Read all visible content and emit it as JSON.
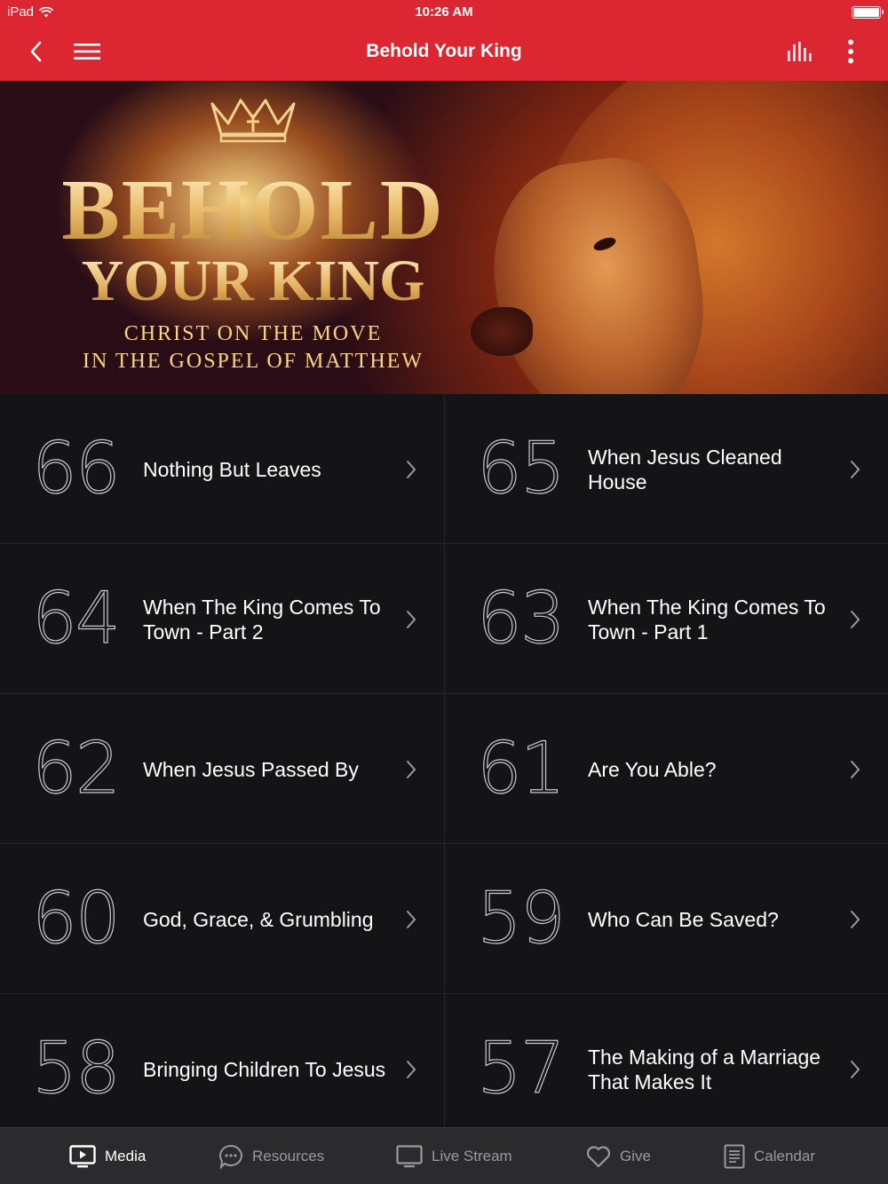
{
  "status_bar": {
    "device": "iPad",
    "time": "10:26 AM"
  },
  "nav": {
    "title": "Behold Your King",
    "back_icon": "chevron-left-icon",
    "menu_icon": "hamburger-icon",
    "audio_icon": "equalizer-icon",
    "more_icon": "more-vertical-icon"
  },
  "hero": {
    "line1": "BEHOLD",
    "line2": "YOUR KING",
    "line3": "CHRIST ON THE MOVE",
    "line4": "IN THE GOSPEL OF MATTHEW"
  },
  "episodes": [
    {
      "number": "66",
      "title": "Nothing But Leaves"
    },
    {
      "number": "65",
      "title": "When Jesus Cleaned House"
    },
    {
      "number": "64",
      "title": "When The King Comes To Town - Part 2"
    },
    {
      "number": "63",
      "title": "When The King Comes To Town - Part 1"
    },
    {
      "number": "62",
      "title": "When Jesus Passed By"
    },
    {
      "number": "61",
      "title": "Are You Able?"
    },
    {
      "number": "60",
      "title": "God, Grace, & Grumbling"
    },
    {
      "number": "59",
      "title": "Who Can Be Saved?"
    },
    {
      "number": "58",
      "title": "Bringing Children To Jesus"
    },
    {
      "number": "57",
      "title": "The Making of a Marriage That Makes It"
    }
  ],
  "tabs": [
    {
      "label": "Media",
      "icon": "media-icon",
      "active": true
    },
    {
      "label": "Resources",
      "icon": "chat-bubble-icon",
      "active": false
    },
    {
      "label": "Live Stream",
      "icon": "monitor-icon",
      "active": false
    },
    {
      "label": "Give",
      "icon": "heart-icon",
      "active": false
    },
    {
      "label": "Calendar",
      "icon": "calendar-icon",
      "active": false
    }
  ],
  "colors": {
    "brand_red": "#dc2631",
    "background": "#141416",
    "tabbar": "#2b2b2e"
  }
}
